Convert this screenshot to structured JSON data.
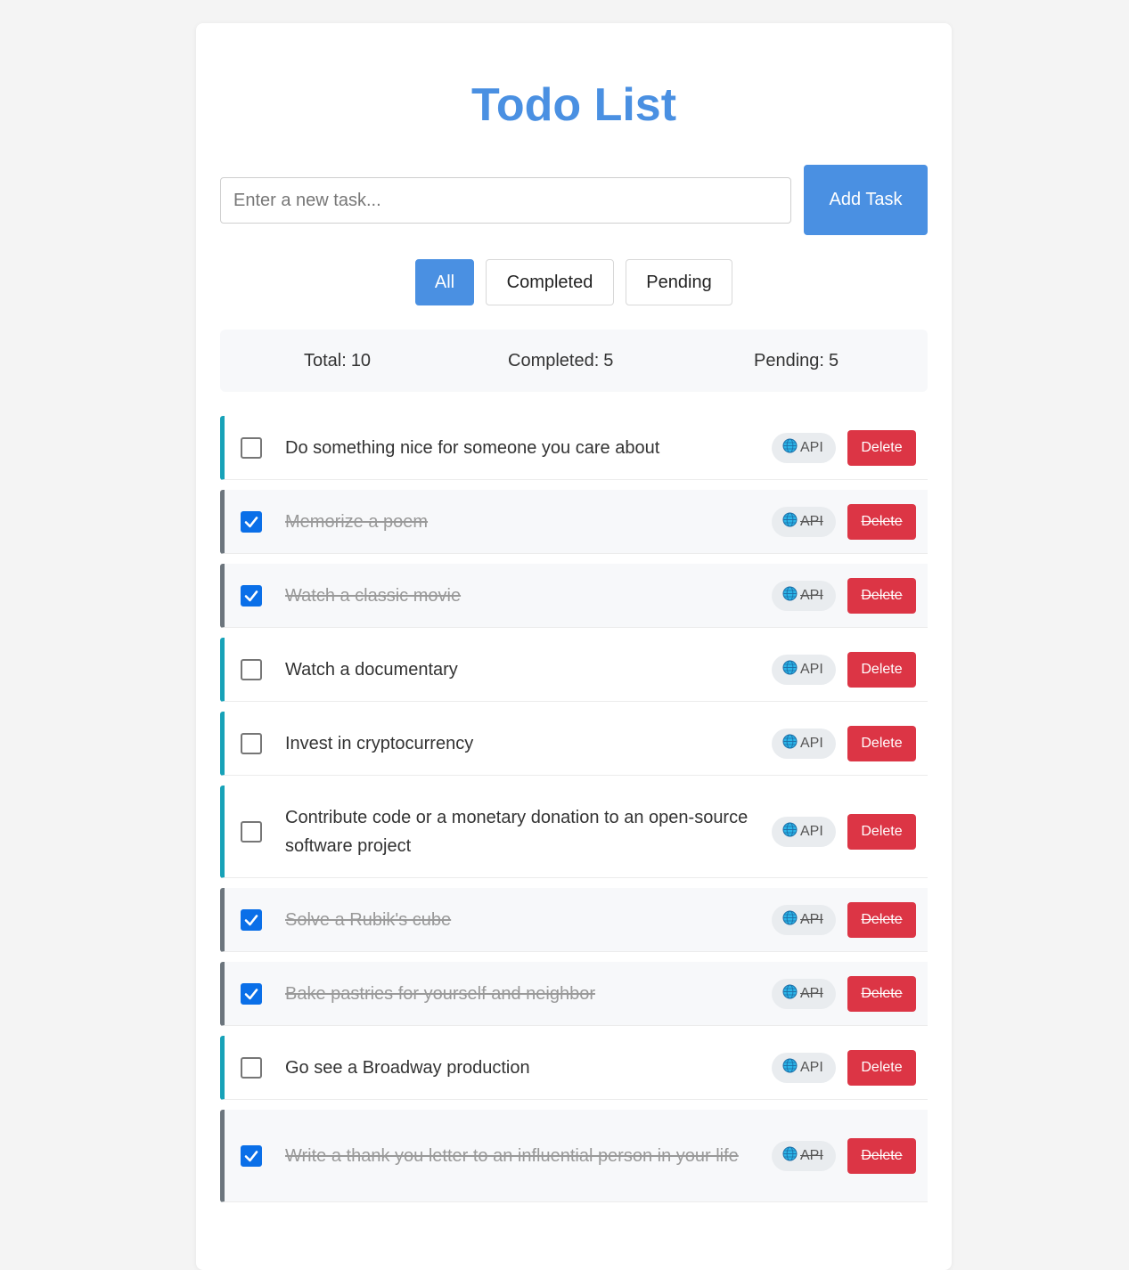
{
  "app": {
    "title": "Todo List"
  },
  "input": {
    "placeholder": "Enter a new task...",
    "value": "",
    "add_label": "Add Task"
  },
  "filters": {
    "all": "All",
    "completed": "Completed",
    "pending": "Pending",
    "active": "All"
  },
  "stats": {
    "total_label": "Total:",
    "total": "10",
    "completed_label": "Completed:",
    "completed": "5",
    "pending_label": "Pending:",
    "pending": "5"
  },
  "todos": [
    {
      "text": "Do something nice for someone you care about",
      "completed": false,
      "badge": "API",
      "delete_label": "Delete"
    },
    {
      "text": "Memorize a poem",
      "completed": true,
      "badge": "API",
      "delete_label": "Delete"
    },
    {
      "text": "Watch a classic movie",
      "completed": true,
      "badge": "API",
      "delete_label": "Delete"
    },
    {
      "text": "Watch a documentary",
      "completed": false,
      "badge": "API",
      "delete_label": "Delete"
    },
    {
      "text": "Invest in cryptocurrency",
      "completed": false,
      "badge": "API",
      "delete_label": "Delete"
    },
    {
      "text": "Contribute code or a monetary donation to an open-source software project",
      "completed": false,
      "badge": "API",
      "delete_label": "Delete"
    },
    {
      "text": "Solve a Rubik's cube",
      "completed": true,
      "badge": "API",
      "delete_label": "Delete"
    },
    {
      "text": "Bake pastries for yourself and neighbor",
      "completed": true,
      "badge": "API",
      "delete_label": "Delete"
    },
    {
      "text": "Go see a Broadway production",
      "completed": false,
      "badge": "API",
      "delete_label": "Delete"
    },
    {
      "text": "Write a thank you letter to an influential person in your life",
      "completed": true,
      "badge": "API",
      "delete_label": "Delete"
    }
  ],
  "colors": {
    "accent": "#4a90e2",
    "pending_border": "#17a2b8",
    "done_border": "#6c757d",
    "delete": "#dc3545",
    "checkbox": "#0a6fe8"
  },
  "icons": {
    "badge_icon": "globe-icon",
    "check_icon": "checkmark-icon"
  }
}
